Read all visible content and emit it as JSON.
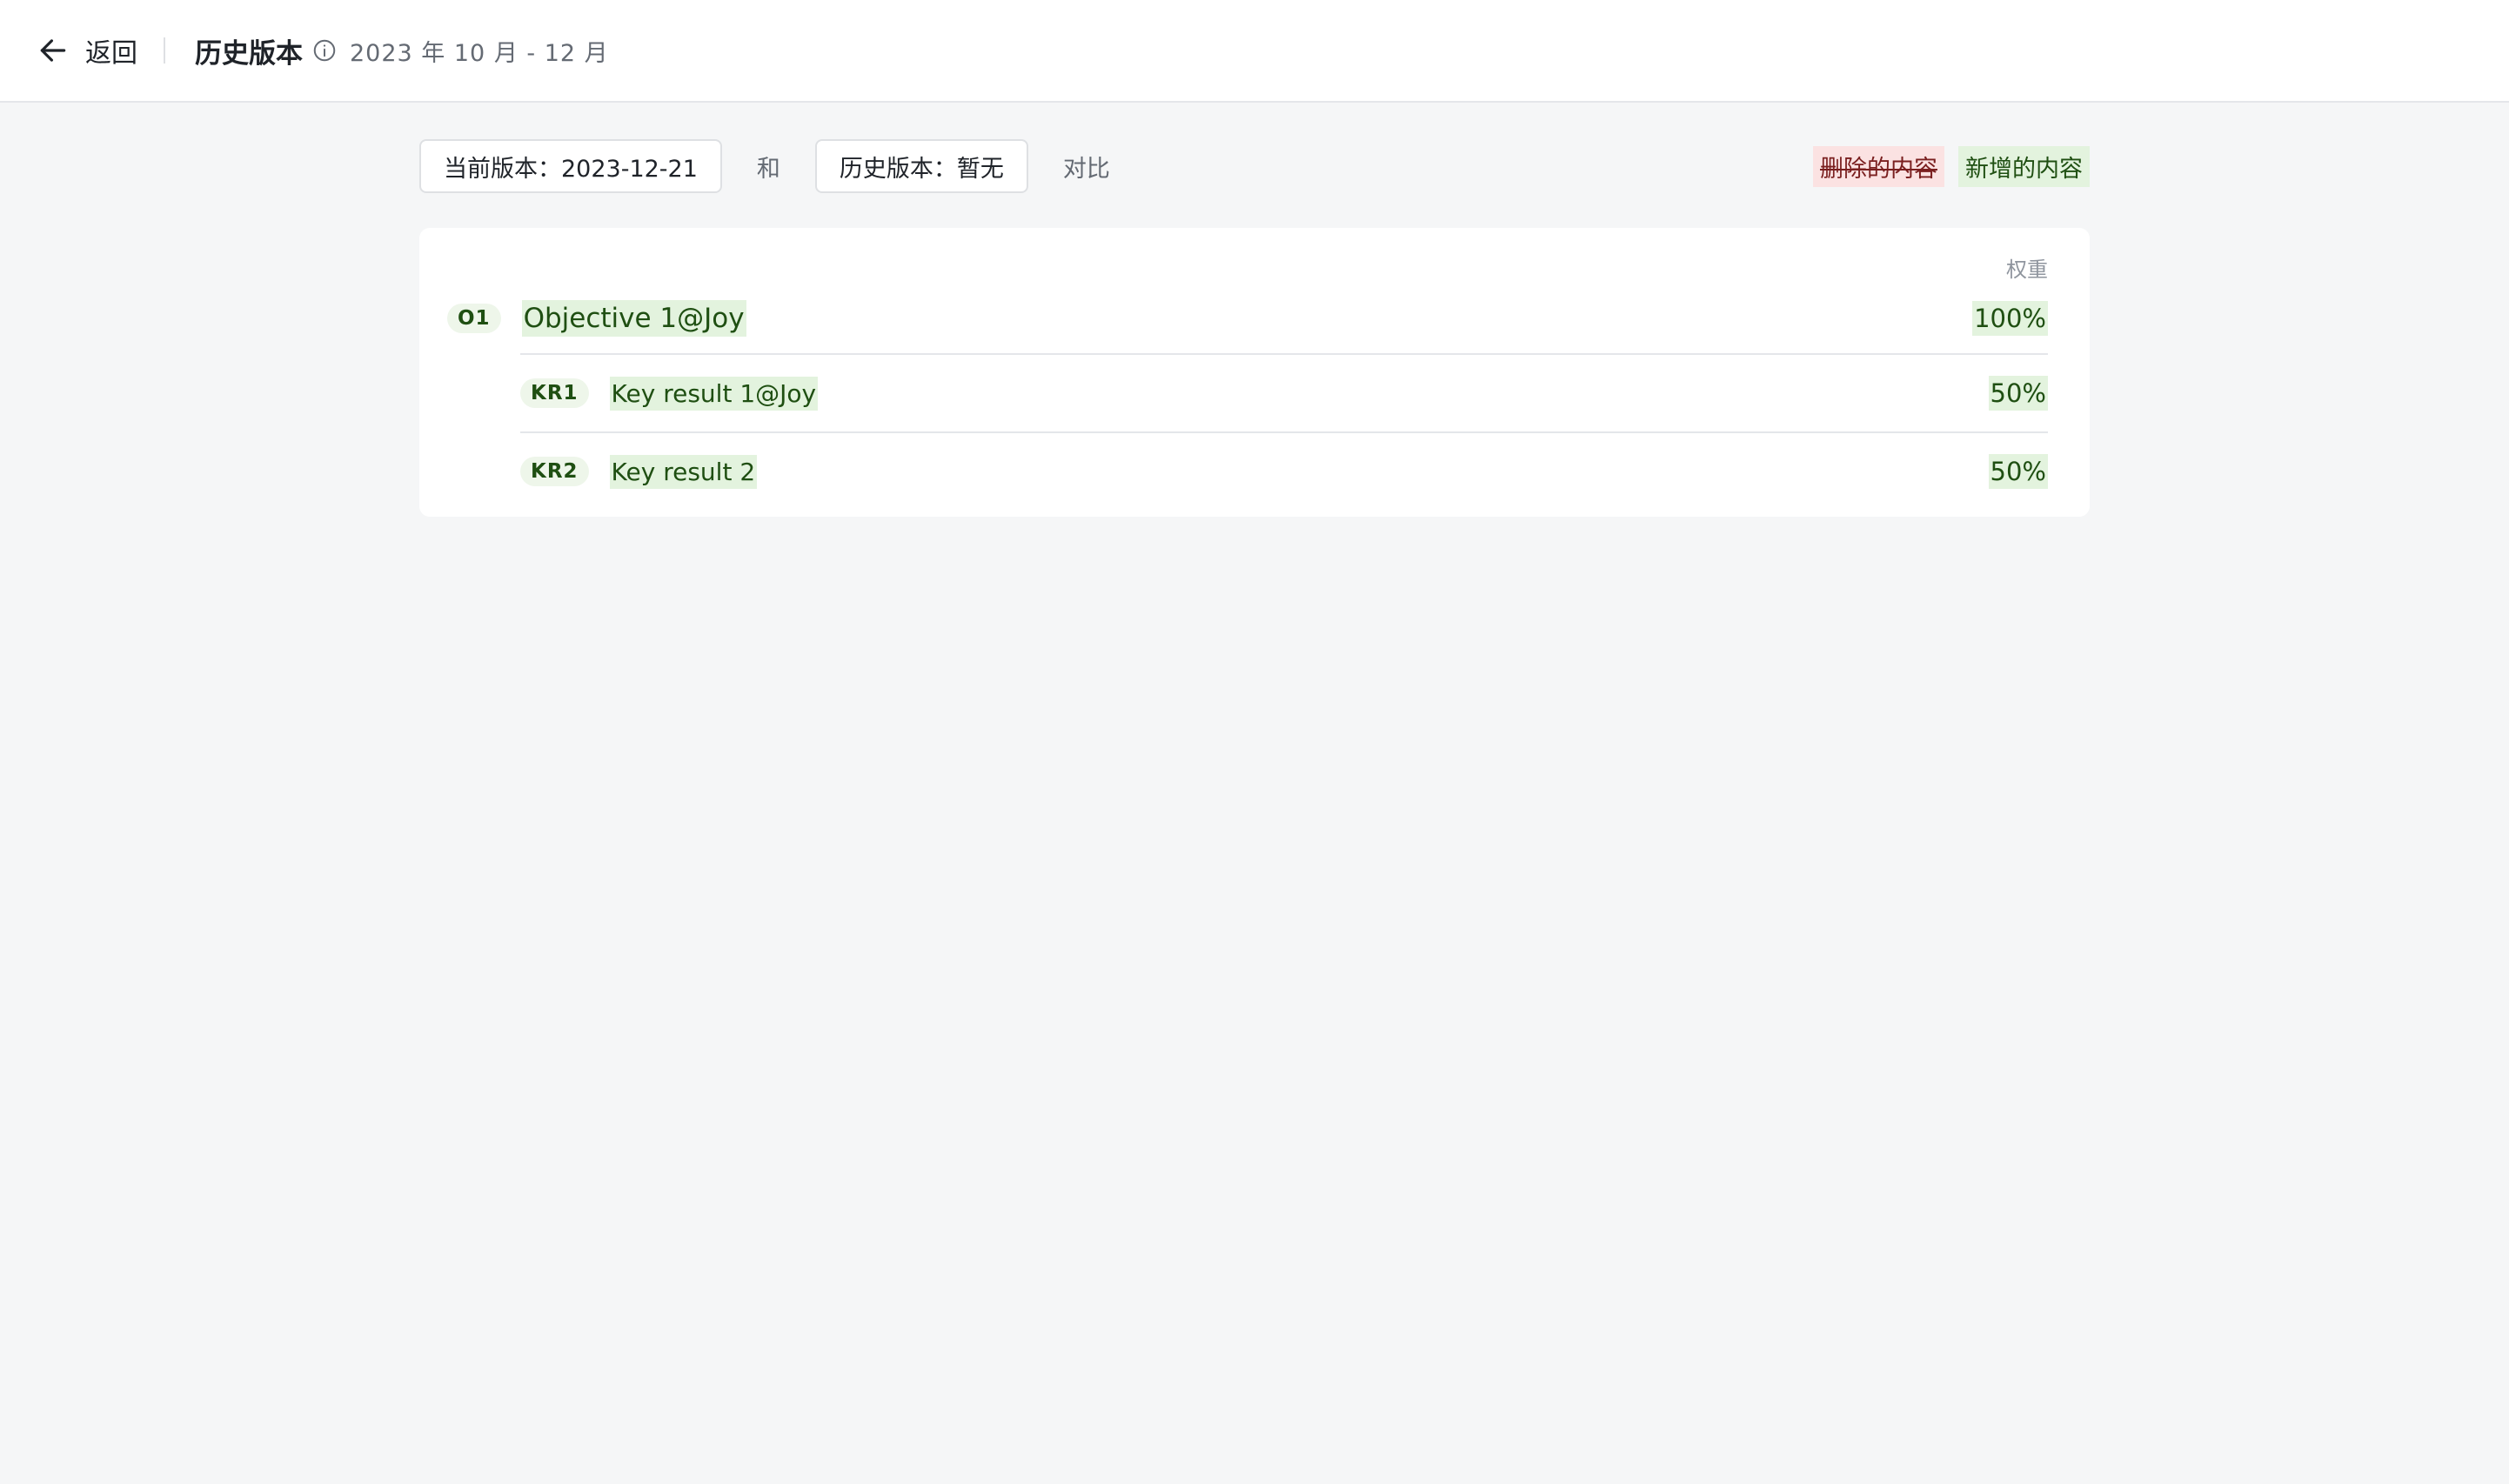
{
  "header": {
    "back_label": "返回",
    "title": "历史版本",
    "period": "2023 年 10 月 - 12 月"
  },
  "compare": {
    "current_version": "当前版本：2023-12-21",
    "and_label": "和",
    "history_version": "历史版本：暂无",
    "compare_label": "对比"
  },
  "legend": {
    "deleted": "删除的内容",
    "added": "新增的内容",
    "deleted_color": "#fbe2e2",
    "added_color": "#e3f3de"
  },
  "okr": {
    "weight_header": "权重",
    "objective": {
      "badge": "O1",
      "title": "Objective 1@Joy",
      "weight": "100%"
    },
    "key_results": [
      {
        "badge": "KR1",
        "title": "Key result 1@Joy",
        "weight": "50%"
      },
      {
        "badge": "KR2",
        "title": "Key result 2",
        "weight": "50%"
      }
    ]
  },
  "icons": {
    "back": "arrow-left-icon",
    "info": "info-circle-icon"
  }
}
